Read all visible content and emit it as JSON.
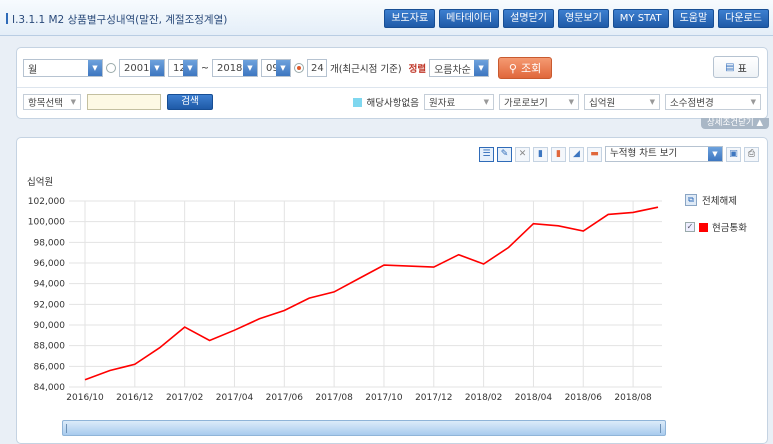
{
  "title": "I.3.1.1 M2 상품별구성내역(말잔, 계절조정계열)",
  "top_buttons": [
    "보도자료",
    "메타데이터",
    "설명닫기",
    "영문보기",
    "MY STAT",
    "도움말",
    "다운로드"
  ],
  "filters": {
    "cycle": "월",
    "start_year": "2001",
    "start_month": "12",
    "tilde": "~",
    "end_year": "2018",
    "end_month": "09",
    "recent_count": "24",
    "recent_label": "개(최근시점 기준)",
    "sort_label": "정렬",
    "sort_value": "오름차순",
    "search_button": "조회",
    "table_button": "표"
  },
  "row2": {
    "item_select": "항목선택",
    "input_value": "",
    "search_button": "검색",
    "na_label": "해당사항없음",
    "source": "원자료",
    "view": "가로로보기",
    "unit": "십억원",
    "decimal": "소수점변경",
    "detail_tab": "상세조건닫기 ▲"
  },
  "chart_toolbar": {
    "chart_type": "누적형 차트 보기"
  },
  "legend": {
    "release_all": "전체해제",
    "series_name": "현금통화",
    "series_color": "#ff0000"
  },
  "chart_data": {
    "type": "line",
    "ylabel": "십억원",
    "ylim": [
      84000,
      102000
    ],
    "yticks": [
      "102,000",
      "100,000",
      "98,000",
      "96,000",
      "94,000",
      "92,000",
      "90,000",
      "88,000",
      "86,000",
      "84,000"
    ],
    "xticks": [
      "2016/10",
      "2016/12",
      "2017/02",
      "2017/04",
      "2017/06",
      "2017/08",
      "2017/10",
      "2017/12",
      "2018/02",
      "2018/04",
      "2018/06",
      "2018/08"
    ],
    "series": [
      {
        "name": "현금통화",
        "color": "#ff0000",
        "x": [
          "2016/10",
          "2016/11",
          "2016/12",
          "2017/01",
          "2017/02",
          "2017/03",
          "2017/04",
          "2017/05",
          "2017/06",
          "2017/07",
          "2017/08",
          "2017/09",
          "2017/10",
          "2017/11",
          "2017/12",
          "2018/01",
          "2018/02",
          "2018/03",
          "2018/04",
          "2018/05",
          "2018/06",
          "2018/07",
          "2018/08",
          "2018/09"
        ],
        "values": [
          84700,
          85600,
          86200,
          87800,
          89800,
          88500,
          89500,
          90600,
          91400,
          92600,
          93200,
          94500,
          95800,
          95700,
          95600,
          96800,
          95900,
          97500,
          99800,
          99600,
          99100,
          100700,
          100900,
          101400
        ]
      }
    ],
    "grid": true
  }
}
